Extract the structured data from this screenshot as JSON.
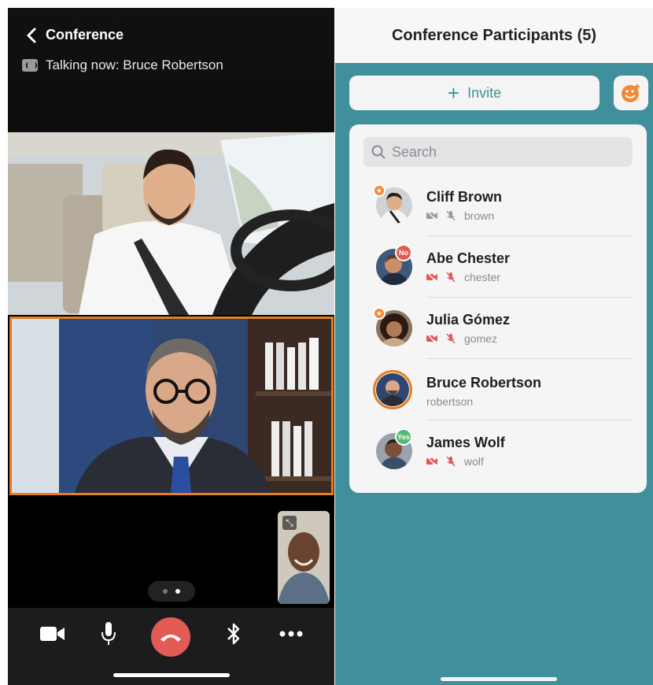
{
  "call": {
    "title": "Conference",
    "talking_now": "Talking now: Bruce Robertson"
  },
  "pager": {
    "pages": 2,
    "current": 2
  },
  "toolbar": {
    "buttons": [
      "camera-icon",
      "microphone-icon",
      "hang-up-icon",
      "bluetooth-icon",
      "more-icon"
    ]
  },
  "panel": {
    "title": "Conference Participants (5)",
    "invite_label": "Invite",
    "search_placeholder": "Search",
    "participants": [
      {
        "name": "Cliff Brown",
        "username": "brown",
        "badge": "",
        "muted_video": true,
        "muted_audio": true
      },
      {
        "name": "Abe Chester",
        "username": "chester",
        "badge": "No",
        "muted_video": true,
        "muted_audio": true
      },
      {
        "name": "Julia Gómez",
        "username": "gomez",
        "badge": "",
        "muted_video": true,
        "muted_audio": true
      },
      {
        "name": "Bruce Robertson",
        "username": "robertson",
        "badge": "",
        "speaking": true
      },
      {
        "name": "James Wolf",
        "username": "wolf",
        "badge": "Yes",
        "muted_video": true,
        "muted_audio": true
      }
    ]
  },
  "colors": {
    "accent_orange": "#e67e22",
    "teal_background": "#3f8f9c",
    "hangup_red": "#e25c55",
    "muted_red": "#e05a4f"
  }
}
